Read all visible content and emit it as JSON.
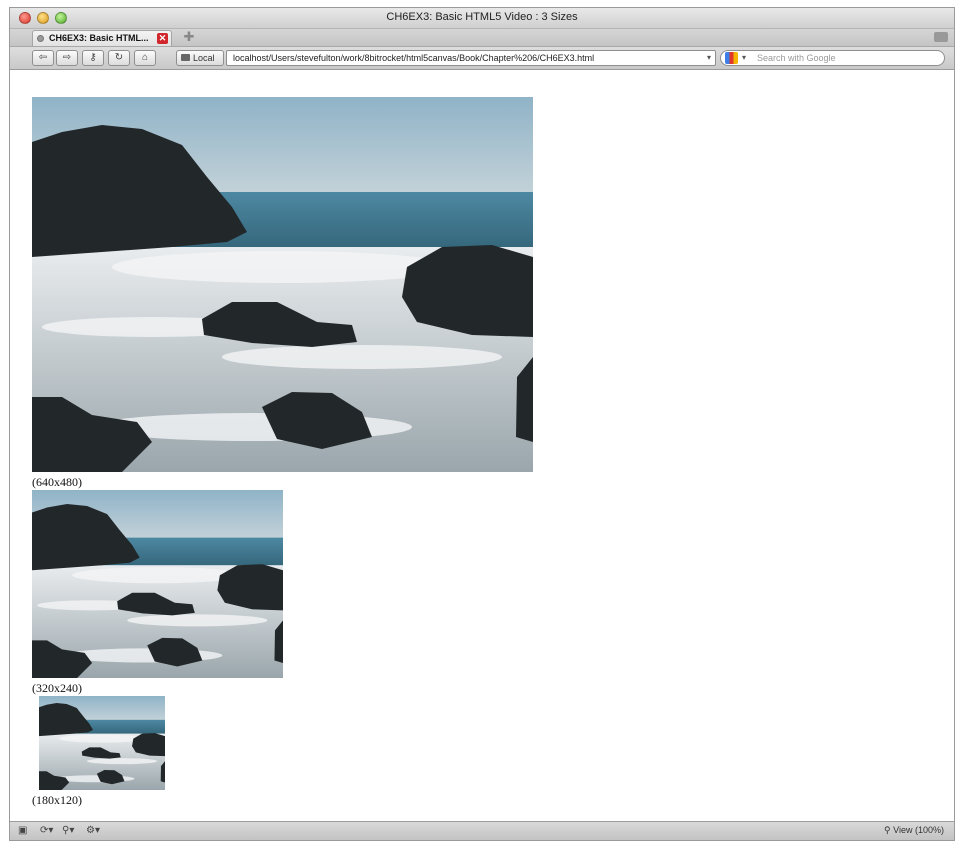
{
  "window": {
    "title": "CH6EX3: Basic HTML5 Video : 3 Sizes"
  },
  "tab": {
    "label": "CH6EX3: Basic HTML..."
  },
  "nav": {
    "back_icon": "back-arrow-icon",
    "forward_icon": "forward-arrow-icon",
    "local_label": "Local",
    "url": "localhost/Users/stevefulton/work/8bitrocket/html5canvas/Book/Chapter%206/CH6EX3.html",
    "search_placeholder": "Search with Google"
  },
  "videos": [
    {
      "caption": "(640x480)"
    },
    {
      "caption": "(320x240)"
    },
    {
      "caption": "(180x120)"
    }
  ],
  "status": {
    "zoom_label": "View (100%)"
  },
  "colors": {
    "sky": "#a9bfcb",
    "sea": "#3f6f86",
    "rock": "#24282a",
    "foam": "#d9dde0"
  }
}
